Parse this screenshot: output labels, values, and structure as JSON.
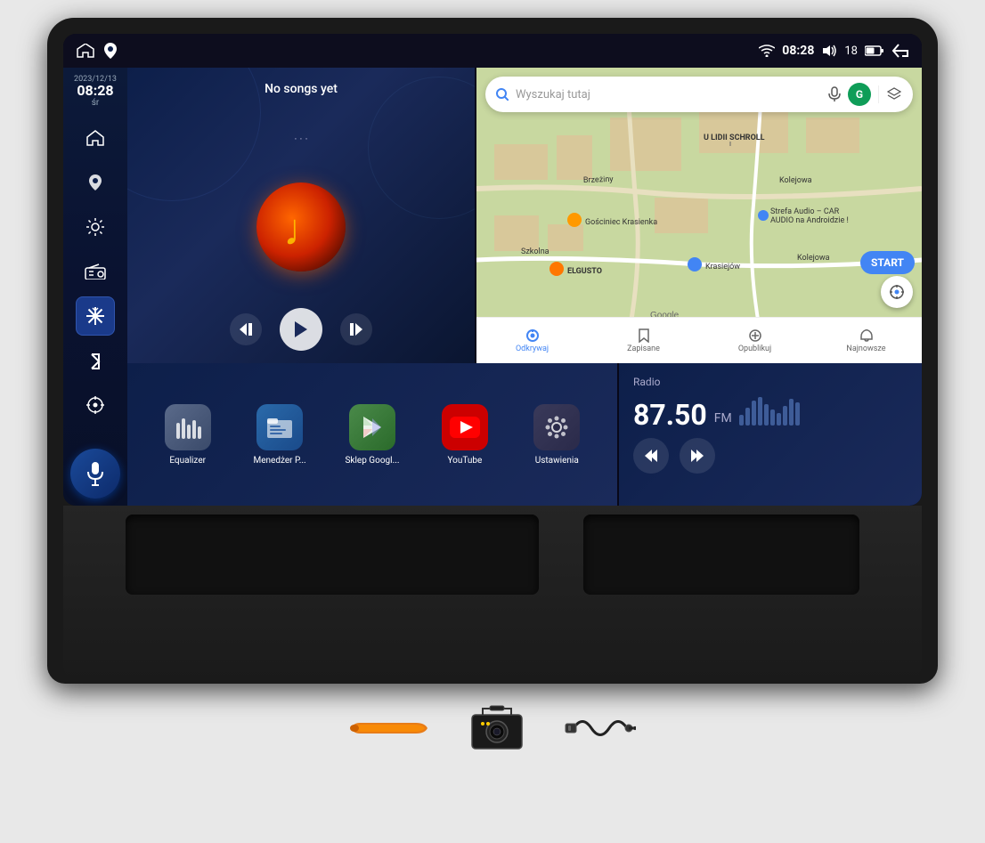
{
  "statusBar": {
    "wifi": "▼",
    "time": "08:28",
    "volume": "◀)",
    "battery": "18",
    "batteryIcon": "▭",
    "back": "↩"
  },
  "sidebar": {
    "date": "2023/12/13",
    "time": "08:28",
    "day": "śr",
    "buttons": [
      {
        "id": "home",
        "icon": "⌂",
        "label": "home"
      },
      {
        "id": "maps",
        "icon": "📍",
        "label": "maps"
      },
      {
        "id": "settings",
        "icon": "⚙",
        "label": "settings"
      },
      {
        "id": "radio",
        "icon": "📻",
        "label": "radio"
      },
      {
        "id": "freeze",
        "icon": "❄",
        "label": "freeze"
      },
      {
        "id": "bluetooth",
        "icon": "Ƀ",
        "label": "bluetooth"
      },
      {
        "id": "location",
        "icon": "◎",
        "label": "location"
      }
    ],
    "voiceIcon": "🎙"
  },
  "musicPlayer": {
    "title": "No songs yet",
    "subtitle": "· · ·"
  },
  "map": {
    "searchPlaceholder": "Wyszukaj tutaj",
    "label_1": "U LIDII SCHROLL",
    "label_2": "Gościniec Krasienka",
    "label_3": "ELGUSTO",
    "label_4": "Strefa Audio – CAR AUDIO na Androidzie !",
    "label_5": "Brzeżiny",
    "label_6": "Szkolna",
    "label_7": "Kolejowa",
    "label_8": "Krasiejów",
    "label_google": "Google",
    "navItems": [
      {
        "label": "Odkrywaj",
        "icon": "📍",
        "active": true
      },
      {
        "label": "Zapisane",
        "icon": "🔖",
        "active": false
      },
      {
        "label": "Opublikuj",
        "icon": "⊕",
        "active": false
      },
      {
        "label": "Najnowsze",
        "icon": "🔔",
        "active": false
      }
    ],
    "startBtn": "START"
  },
  "apps": [
    {
      "id": "equalizer",
      "label": "Equalizer",
      "colorClass": "app-equalizer"
    },
    {
      "id": "files",
      "label": "Menedżer P...",
      "colorClass": "app-files"
    },
    {
      "id": "play",
      "label": "Sklep Googl...",
      "colorClass": "app-play"
    },
    {
      "id": "youtube",
      "label": "YouTube",
      "colorClass": "app-youtube"
    },
    {
      "id": "settings",
      "label": "Ustawienia",
      "colorClass": "app-settings"
    }
  ],
  "radio": {
    "label": "Radio",
    "frequency": "87.50",
    "band": "FM"
  }
}
